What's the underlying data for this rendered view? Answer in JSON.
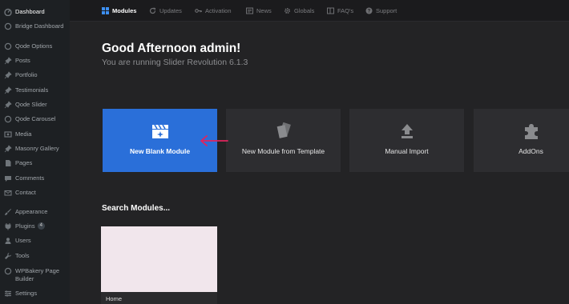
{
  "sidebar": {
    "items": [
      {
        "label": "Dashboard",
        "icon": "dashboard-icon",
        "state": "active-parent"
      },
      {
        "label": "Bridge Dashboard",
        "icon": "circle-icon"
      },
      {
        "label": "Qode Options",
        "icon": "circle-icon"
      },
      {
        "label": "Posts",
        "icon": "pin-icon"
      },
      {
        "label": "Portfolio",
        "icon": "pin-icon"
      },
      {
        "label": "Testimonials",
        "icon": "pin-icon"
      },
      {
        "label": "Qode Slider",
        "icon": "pin-icon"
      },
      {
        "label": "Qode Carousel",
        "icon": "circle-icon"
      },
      {
        "label": "Media",
        "icon": "media-icon"
      },
      {
        "label": "Masonry Gallery",
        "icon": "pin-icon"
      },
      {
        "label": "Pages",
        "icon": "page-icon"
      },
      {
        "label": "Comments",
        "icon": "comment-icon"
      },
      {
        "label": "Contact",
        "icon": "mail-icon"
      },
      {
        "label": "Appearance",
        "icon": "brush-icon"
      },
      {
        "label": "Plugins",
        "icon": "plug-icon",
        "badge": "4"
      },
      {
        "label": "Users",
        "icon": "user-icon"
      },
      {
        "label": "Tools",
        "icon": "wrench-icon"
      },
      {
        "label": "WPBakery Page Builder",
        "icon": "circle-icon"
      },
      {
        "label": "Settings",
        "icon": "settings-icon"
      }
    ]
  },
  "topnav": {
    "items": [
      {
        "label": "Modules",
        "icon": "grid-icon",
        "active": true
      },
      {
        "label": "Updates",
        "icon": "refresh-icon"
      },
      {
        "label": "Activation",
        "icon": "key-icon"
      },
      {
        "label": "News",
        "icon": "news-icon"
      },
      {
        "label": "Globals",
        "icon": "gear-icon"
      },
      {
        "label": "FAQ's",
        "icon": "faq-icon"
      },
      {
        "label": "Support",
        "icon": "help-icon"
      }
    ]
  },
  "greeting": {
    "title": "Good Afternoon admin!",
    "subtitle": "You are running Slider Revolution 6.1.3"
  },
  "cards": [
    {
      "label": "New Blank Module",
      "icon": "clapper-sparkle-icon",
      "primary": true
    },
    {
      "label": "New Module from Template",
      "icon": "template-cards-icon"
    },
    {
      "label": "Manual Import",
      "icon": "upload-icon"
    },
    {
      "label": "AddOns",
      "icon": "puzzle-icon"
    }
  ],
  "colors": {
    "accent": "#2a6fd9",
    "arrow": "#e0245e"
  },
  "search": {
    "heading": "Search Modules..."
  },
  "modules": [
    {
      "name": "Home"
    }
  ]
}
